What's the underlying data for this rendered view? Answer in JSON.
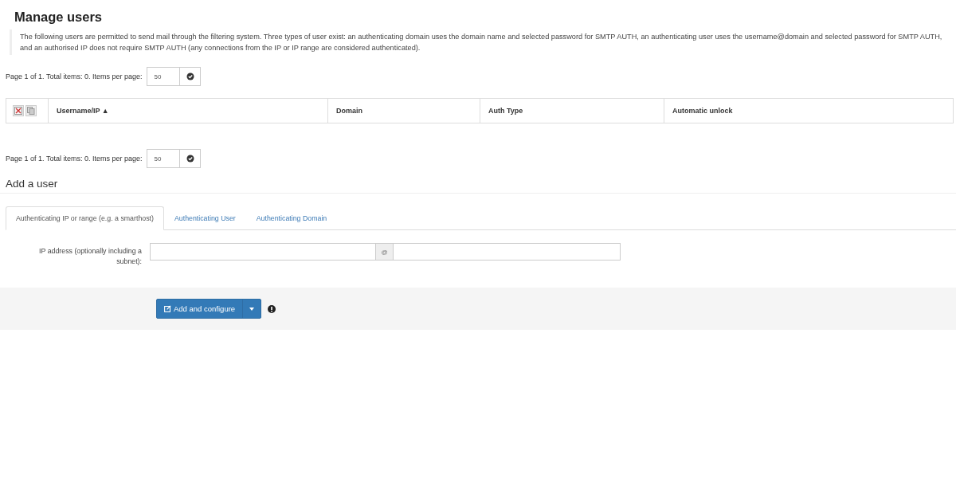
{
  "title": "Manage users",
  "description": "The following users are permitted to send mail through the filtering system. Three types of user exist: an authenticating domain uses the domain name and selected password for SMTP AUTH, an authenticating user uses the username@domain and selected password for SMTP AUTH, and an authorised IP does not require SMTP AUTH (any connections from the IP or IP range are considered authenticated).",
  "pagers": [
    {
      "text": "Page 1 of 1. Total items: 0. Items per page:",
      "per_page": "50"
    },
    {
      "text": "Page 1 of 1. Total items: 0. Items per page:",
      "per_page": "50"
    }
  ],
  "table": {
    "columns": [
      {
        "label": "Username/IP ▲"
      },
      {
        "label": "Domain"
      },
      {
        "label": "Auth Type"
      },
      {
        "label": "Automatic unlock"
      }
    ]
  },
  "add_user": {
    "heading": "Add a user",
    "tabs": [
      {
        "label": "Authenticating IP or range (e.g. a smarthost)",
        "selected": true
      },
      {
        "label": "Authenticating User",
        "selected": false
      },
      {
        "label": "Authenticating Domain",
        "selected": false
      }
    ],
    "field": {
      "label": "IP address (optionally including a subnet):",
      "separator": "@"
    },
    "button": {
      "label": "Add and configure"
    }
  }
}
